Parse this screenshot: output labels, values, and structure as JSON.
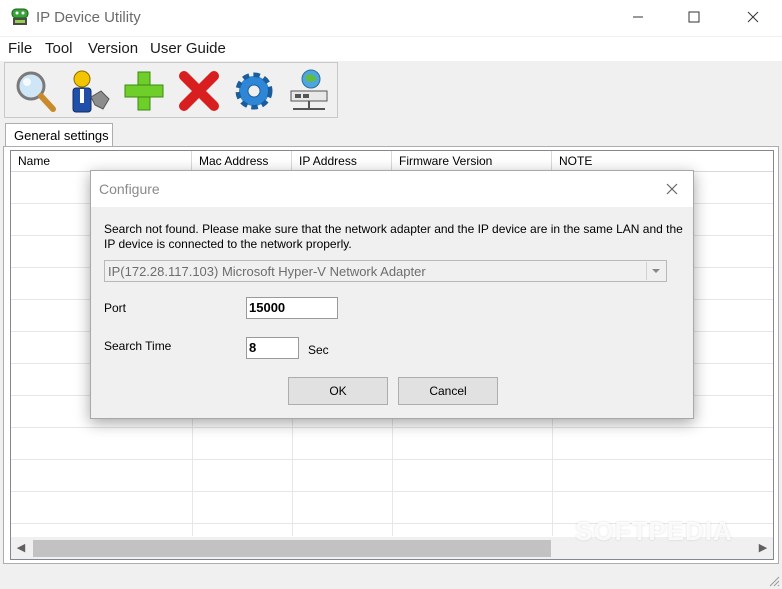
{
  "window": {
    "title": "IP Device Utility",
    "icon": "green-robot-icon"
  },
  "menu": [
    "File",
    "Tool",
    "Version",
    "User Guide"
  ],
  "toolbar": {
    "tools": [
      "search-icon",
      "user-key-icon",
      "add-icon",
      "delete-icon",
      "settings-gear-icon",
      "network-device-icon"
    ]
  },
  "tab": {
    "label": "General settings"
  },
  "table": {
    "columns": [
      "Name",
      "Mac Address",
      "IP Address",
      "Firmware Version",
      "NOTE"
    ],
    "rows": []
  },
  "watermark": "SOFTPEDIA",
  "dialog": {
    "title": "Configure",
    "message": "Search not found. Please make sure that the network adapter and the IP device are in the same LAN and the IP device is connected to the network properly.",
    "adapter": "IP(172.28.117.103) Microsoft Hyper-V Network Adapter",
    "port_label": "Port",
    "port_value": "15000",
    "search_time_label": "Search Time",
    "search_time_value": "8",
    "search_time_unit": "Sec",
    "ok_label": "OK",
    "cancel_label": "Cancel"
  },
  "colors": {
    "accent_green": "#6fcf2a",
    "delete_red": "#d81e1e",
    "gear_blue": "#2e86d6"
  }
}
